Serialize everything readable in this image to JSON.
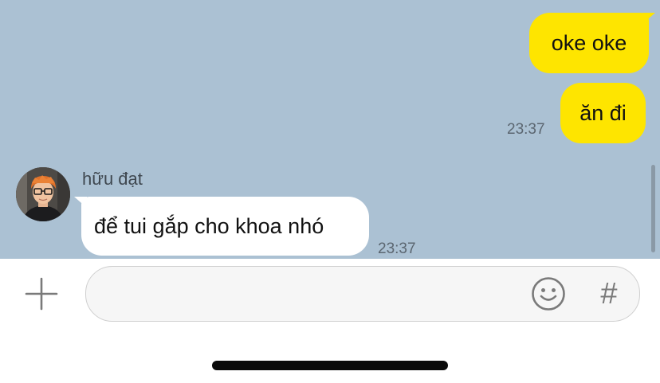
{
  "messages": [
    {
      "from": "me",
      "text": "oke oke"
    },
    {
      "from": "me",
      "text": "ăn đi",
      "time": "23:37"
    },
    {
      "from": "other",
      "sender": "hữu đạt",
      "text": "để tui gắp cho khoa nhó",
      "time": "23:37"
    }
  ],
  "composer": {
    "placeholder": "",
    "plus_icon": "plus-icon",
    "emoji_icon": "smiley-icon",
    "hashtag_label": "#"
  },
  "colors": {
    "chat_background": "#abc1d3",
    "my_bubble": "#fee500",
    "other_bubble": "#ffffff"
  }
}
